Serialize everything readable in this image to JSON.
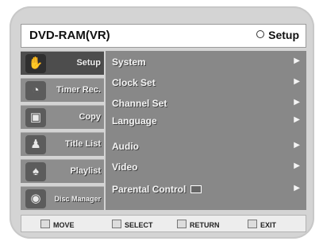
{
  "header": {
    "title": "DVD-RAM(VR)",
    "section": "Setup",
    "section_icon": "circle-icon"
  },
  "sidebar": {
    "items": [
      {
        "label": "Setup",
        "icon": "setup-icon",
        "glyph": "✋"
      },
      {
        "label": "Timer Rec.",
        "icon": "timer-icon",
        "glyph": "◔"
      },
      {
        "label": "Copy",
        "icon": "copy-icon",
        "glyph": "▣"
      },
      {
        "label": "Title List",
        "icon": "title-list-icon",
        "glyph": "♟"
      },
      {
        "label": "Playlist",
        "icon": "playlist-icon",
        "glyph": "♠"
      },
      {
        "label": "Disc Manager",
        "icon": "disc-icon",
        "glyph": "◉"
      }
    ]
  },
  "menu": {
    "items": [
      {
        "label": "System",
        "arrow": "▶"
      },
      {
        "label": "Clock Set",
        "arrow": "▶"
      },
      {
        "label": "Channel Set",
        "arrow": "▶"
      },
      {
        "label": "Language",
        "arrow": "▶"
      },
      {
        "label": "Audio",
        "arrow": "▶"
      },
      {
        "label": "Video",
        "arrow": "▶"
      },
      {
        "label": "Parental Control",
        "arrow": "▶"
      }
    ]
  },
  "footer": {
    "move": "MOVE",
    "select": "SELECT",
    "return": "RETURN",
    "exit": "EXIT"
  }
}
